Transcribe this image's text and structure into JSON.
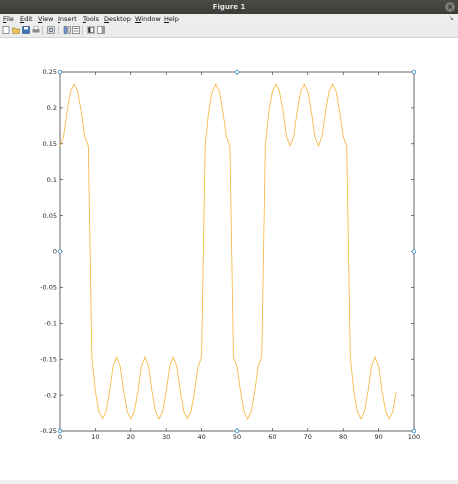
{
  "window": {
    "title": "Figure 1",
    "close_glyph": "×"
  },
  "menu": {
    "items": [
      {
        "label": "File",
        "mnemonic": "F",
        "rest": "ile"
      },
      {
        "label": "Edit",
        "mnemonic": "E",
        "rest": "dit"
      },
      {
        "label": "View",
        "mnemonic": "V",
        "rest": "iew"
      },
      {
        "label": "Insert",
        "mnemonic": "I",
        "rest": "nsert"
      },
      {
        "label": "Tools",
        "mnemonic": "T",
        "rest": "ools"
      },
      {
        "label": "Desktop",
        "mnemonic": "D",
        "rest": "esktop"
      },
      {
        "label": "Window",
        "mnemonic": "W",
        "rest": "indow"
      },
      {
        "label": "Help",
        "mnemonic": "H",
        "rest": "elp"
      }
    ],
    "overflow_arrow": "↘"
  },
  "toolbar": {
    "buttons": [
      "new-figure-icon",
      "open-file-icon",
      "save-icon",
      "print-icon",
      "link-plot-icon",
      "insert-colorbar-icon",
      "insert-legend-icon",
      "hide-plot-tools-icon",
      "show-plot-tools-icon"
    ]
  },
  "colors": {
    "line": "#f5b43a",
    "axis": "#262626",
    "marker": "#0072bd"
  },
  "chart_data": {
    "type": "line",
    "title": "",
    "xlabel": "",
    "ylabel": "",
    "xlim": [
      0,
      100
    ],
    "ylim": [
      -0.25,
      0.25
    ],
    "xticks": [
      0,
      10,
      20,
      30,
      40,
      50,
      60,
      70,
      80,
      90,
      100
    ],
    "yticks": [
      -0.25,
      -0.2,
      -0.15,
      -0.1,
      -0.05,
      0,
      0.05,
      0.1,
      0.15,
      0.2,
      0.25
    ],
    "xtick_labels": [
      "0",
      "10",
      "20",
      "30",
      "40",
      "50",
      "60",
      "70",
      "80",
      "90",
      "100"
    ],
    "ytick_labels": [
      "-0.25",
      "-0.2",
      "-0.15",
      "-0.1",
      "-0.05",
      "0",
      "0.05",
      "0.1",
      "0.15",
      "0.2",
      "0.25"
    ],
    "grid": false,
    "series": [
      {
        "x": [
          0,
          1,
          2,
          3,
          4,
          5,
          6,
          7,
          8,
          9,
          10,
          11,
          12,
          13,
          14,
          15,
          16,
          17,
          18,
          19,
          20,
          21,
          22,
          23,
          24,
          25,
          26,
          27,
          28,
          29,
          30,
          31,
          32,
          33,
          34,
          35,
          36,
          37,
          38,
          39,
          40,
          41,
          42,
          43,
          44,
          45,
          46,
          47,
          48,
          49,
          50,
          51,
          52,
          53,
          54,
          55,
          56,
          57,
          58,
          59,
          60,
          61,
          62,
          63,
          64,
          65,
          66,
          67,
          68,
          69,
          70,
          71,
          72,
          73,
          74,
          75,
          76,
          77,
          78,
          79,
          80,
          81,
          82,
          83,
          84,
          85,
          86,
          87,
          88,
          89,
          90,
          91,
          92,
          93,
          94,
          95
        ],
        "y": [
          0.147,
          0.16,
          0.195,
          0.223,
          0.233,
          0.223,
          0.195,
          0.16,
          0.147,
          -0.147,
          -0.195,
          -0.223,
          -0.233,
          -0.223,
          -0.195,
          -0.16,
          -0.147,
          -0.16,
          -0.195,
          -0.223,
          -0.233,
          -0.223,
          -0.195,
          -0.16,
          -0.147,
          -0.16,
          -0.195,
          -0.223,
          -0.233,
          -0.223,
          -0.195,
          -0.16,
          -0.147,
          -0.16,
          -0.195,
          -0.223,
          -0.233,
          -0.223,
          -0.195,
          -0.16,
          -0.147,
          0.147,
          0.195,
          0.223,
          0.233,
          0.223,
          0.195,
          0.16,
          0.147,
          -0.147,
          -0.16,
          -0.195,
          -0.223,
          -0.233,
          -0.223,
          -0.195,
          -0.16,
          -0.147,
          0.147,
          0.195,
          0.223,
          0.233,
          0.223,
          0.195,
          0.16,
          0.147,
          0.16,
          0.195,
          0.223,
          0.233,
          0.223,
          0.195,
          0.16,
          0.147,
          0.16,
          0.195,
          0.223,
          0.233,
          0.223,
          0.195,
          0.16,
          0.147,
          -0.147,
          -0.195,
          -0.223,
          -0.233,
          -0.223,
          -0.195,
          -0.16,
          -0.147,
          -0.16,
          -0.195,
          -0.223,
          -0.233,
          -0.223,
          -0.195
        ]
      }
    ],
    "selection_markers": [
      [
        0,
        0.25
      ],
      [
        50,
        0.25
      ],
      [
        100,
        0.25
      ],
      [
        0,
        0
      ],
      [
        100,
        0
      ],
      [
        0,
        -0.25
      ],
      [
        50,
        -0.25
      ],
      [
        100,
        -0.25
      ]
    ]
  }
}
